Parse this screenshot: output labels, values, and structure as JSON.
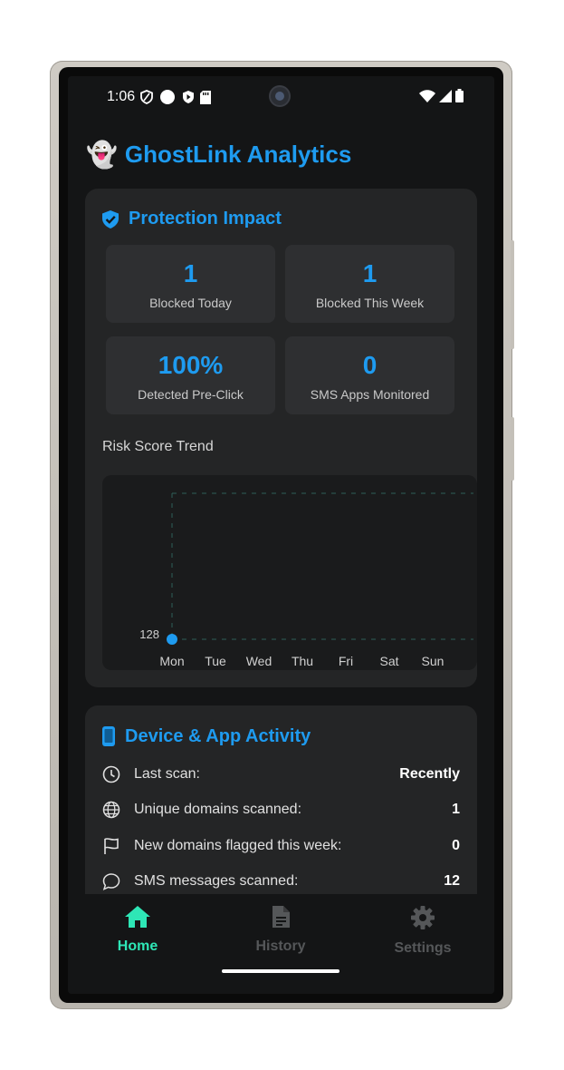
{
  "status_bar": {
    "time": "1:06"
  },
  "app": {
    "title": "GhostLink Analytics",
    "logo_icon": "ghost-emoji"
  },
  "protection": {
    "title": "Protection Impact",
    "stats": [
      {
        "value": "1",
        "label": "Blocked Today"
      },
      {
        "value": "1",
        "label": "Blocked This Week"
      },
      {
        "value": "100%",
        "label": "Detected Pre-Click"
      },
      {
        "value": "0",
        "label": "SMS Apps Monitored"
      }
    ],
    "trend_title": "Risk Score Trend"
  },
  "chart_data": {
    "type": "line",
    "categories": [
      "Mon",
      "Tue",
      "Wed",
      "Thu",
      "Fri",
      "Sat",
      "Sun"
    ],
    "series": [
      {
        "values": [
          128
        ]
      }
    ],
    "tick_labels": [
      "128"
    ],
    "grid": true
  },
  "activity": {
    "title": "Device & App Activity",
    "rows": [
      {
        "icon": "clock-icon",
        "label": "Last scan:",
        "value": "Recently"
      },
      {
        "icon": "globe-icon",
        "label": "Unique domains scanned:",
        "value": "1"
      },
      {
        "icon": "flag-icon",
        "label": "New domains flagged this week:",
        "value": "0"
      },
      {
        "icon": "chat-bubble-icon",
        "label": "SMS messages scanned:",
        "value": "12"
      }
    ]
  },
  "nav": {
    "items": [
      {
        "label": "Home",
        "active": true
      },
      {
        "label": "History",
        "active": false
      },
      {
        "label": "Settings",
        "active": false
      }
    ]
  },
  "colors": {
    "accent": "#1e9bf0",
    "active_nav": "#2ee6b6",
    "inactive_nav": "#555759"
  }
}
